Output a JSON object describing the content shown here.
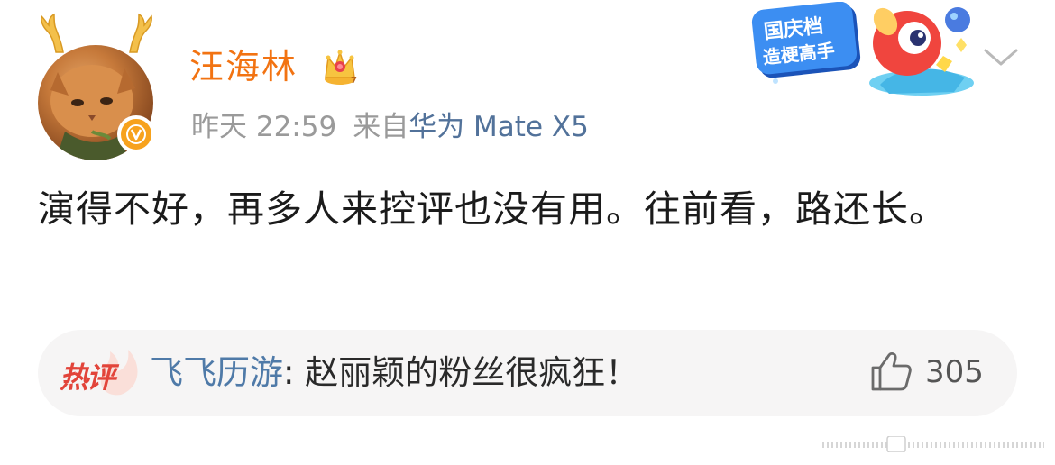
{
  "user": {
    "name": "汪海林"
  },
  "post": {
    "time": "昨天 22:59",
    "source_prefix": "来自",
    "source_device": "华为 Mate X5",
    "text": "演得不好，再多人来控评也没有用。往前看，路还长。"
  },
  "promo": {
    "line1": "国庆档",
    "line2": "造梗高手"
  },
  "hot_comment": {
    "tag": "热评",
    "commenter": "飞飞历游",
    "separator": ": ",
    "text": "赵丽颖的粉丝很疯狂！",
    "likes": "305"
  },
  "colors": {
    "username": "#f27312",
    "link": "#4f7aa8",
    "hot_tag": "#e2443a",
    "meta": "#9a9a9a"
  },
  "icons": {
    "avatar_badge": "v-badge-icon",
    "crown": "crown-icon",
    "menu": "chevron-down-icon",
    "like": "thumbs-up-icon"
  }
}
